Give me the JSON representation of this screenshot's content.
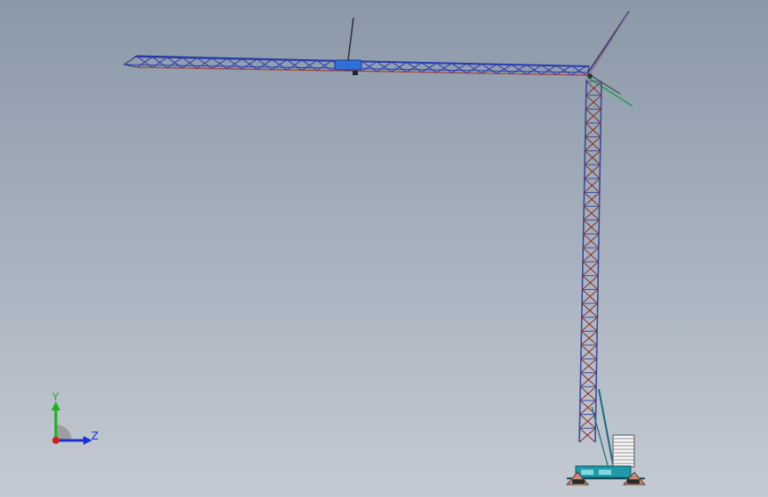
{
  "viewport": {
    "background_top": "#8b98a8",
    "background_bottom": "#c3cad3"
  },
  "model": {
    "name": "tower-crane-assembly",
    "colors": {
      "jib_truss": "#2a3cb0",
      "jib_chord": "#b04a3a",
      "tower_lattice": "#8a2a22",
      "tower_edge": "#3c4a9a",
      "trolley": "#2f6fd8",
      "counter_member": "#23a24a",
      "base": "#1e9aa8"
    }
  },
  "triad": {
    "y_label": "Y",
    "z_label": "Z",
    "y_color": "#1bb31b",
    "z_color": "#1a2fd6",
    "origin_color": "#d81c1c"
  }
}
